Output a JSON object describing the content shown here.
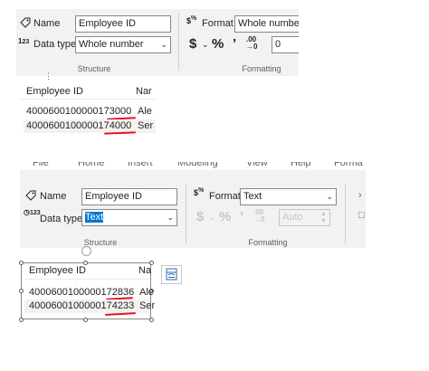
{
  "top": {
    "structure": {
      "name_label": "Name",
      "name_value": "Employee ID",
      "datatype_label": "Data type",
      "datatype_value": "Whole number",
      "caption": "Structure"
    },
    "formatting": {
      "format_label": "Format",
      "format_value": "Whole number",
      "currency": "$",
      "percent": "%",
      "comma": "’",
      "decimals": "0",
      "caption": "Formatting"
    },
    "table": {
      "headers": [
        "Employee ID",
        "Nar"
      ],
      "rows": [
        {
          "prefix": "4000600100000173",
          "underlined": "000",
          "name": "Ale"
        },
        {
          "prefix": "4000600100000174",
          "underlined": "000",
          "name": "Ser"
        }
      ]
    }
  },
  "bottom": {
    "menu": [
      "File",
      "Home",
      "Insert",
      "Modeling",
      "View",
      "Help",
      "Forma"
    ],
    "structure": {
      "name_label": "Name",
      "name_value": "Employee ID",
      "datatype_label": "Data type",
      "datatype_value": "Text",
      "caption": "Structure"
    },
    "formatting": {
      "format_label": "Format",
      "format_value": "Text",
      "currency": "$",
      "percent": "%",
      "comma": "’",
      "auto": "Auto",
      "caption": "Formatting"
    },
    "table": {
      "headers": [
        "Employee ID",
        "Na"
      ],
      "rows": [
        {
          "prefix": "4000600100000172",
          "underlined": "836",
          "name": "Ale"
        },
        {
          "prefix": "4000600100000174",
          "underlined": "233",
          "name": "Ser"
        }
      ]
    }
  },
  "icons": [
    "tag-icon",
    "data-type-123-icon",
    "format-percent-icon",
    "decimal-decrease-icon",
    "visual-icon"
  ],
  "colors": {
    "ribbon_bg": "#f3f2f1",
    "underline": "#e81123",
    "selection": "#0078d4",
    "visual_icon": "#2b6cb0"
  }
}
